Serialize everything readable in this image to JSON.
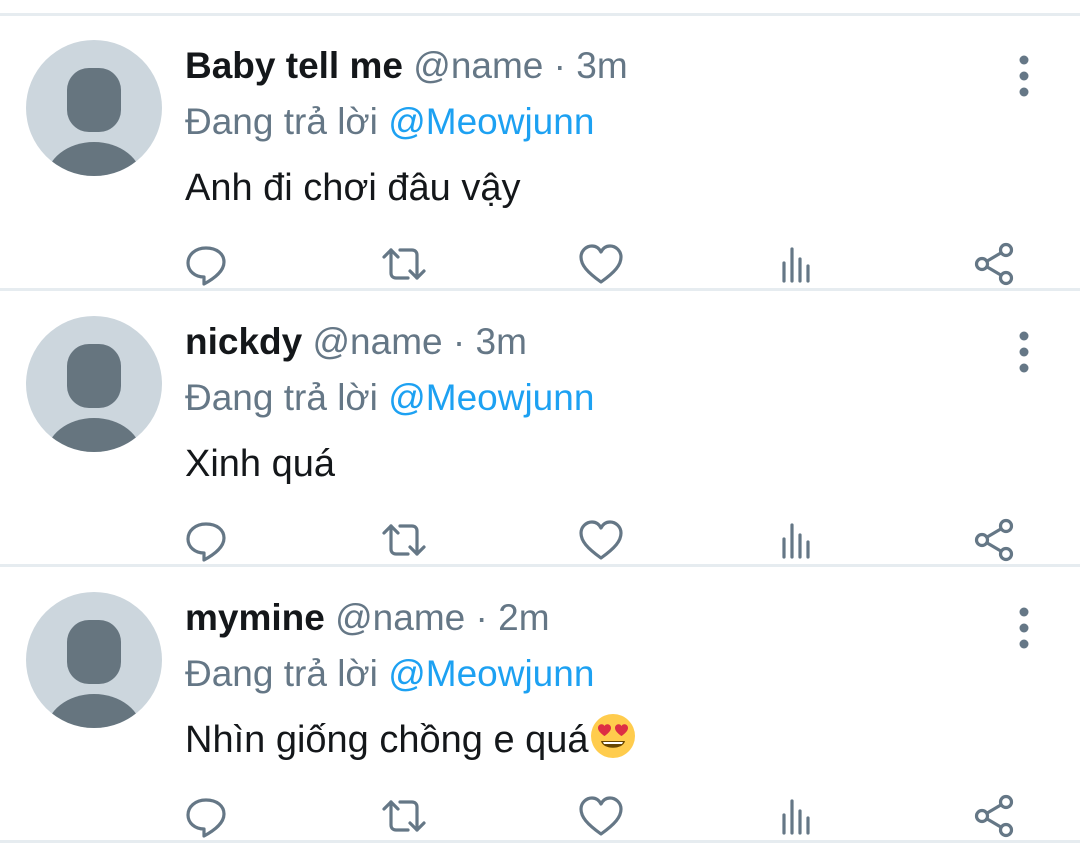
{
  "reply_prefix": "Đang trả lời",
  "icons": {
    "reply": "speech-bubble-icon",
    "retweet": "retweet-icon",
    "like": "heart-icon",
    "analytics": "bar-chart-icon",
    "share": "share-icon",
    "more": "vertical-dots-icon"
  },
  "colors": {
    "mention": "#1da1f2",
    "secondary_text": "#657786",
    "primary_text": "#14171a",
    "avatar_bg": "#ccd6dd",
    "avatar_fg": "#66757f"
  },
  "tweets": [
    {
      "display_name": "Baby tell me",
      "handle": "@name",
      "time": "3m",
      "reply_to": "@Meowjunn",
      "text": "Anh đi chơi đâu vậy",
      "emoji": ""
    },
    {
      "display_name": "nickdy",
      "handle": "@name",
      "time": "3m",
      "reply_to": "@Meowjunn",
      "text": "Xinh quá",
      "emoji": ""
    },
    {
      "display_name": "mymine",
      "handle": "@name",
      "time": "2m",
      "reply_to": "@Meowjunn",
      "text": "Nhìn giống chồng e quá",
      "emoji": "smiling-face-with-heart-eyes"
    }
  ]
}
